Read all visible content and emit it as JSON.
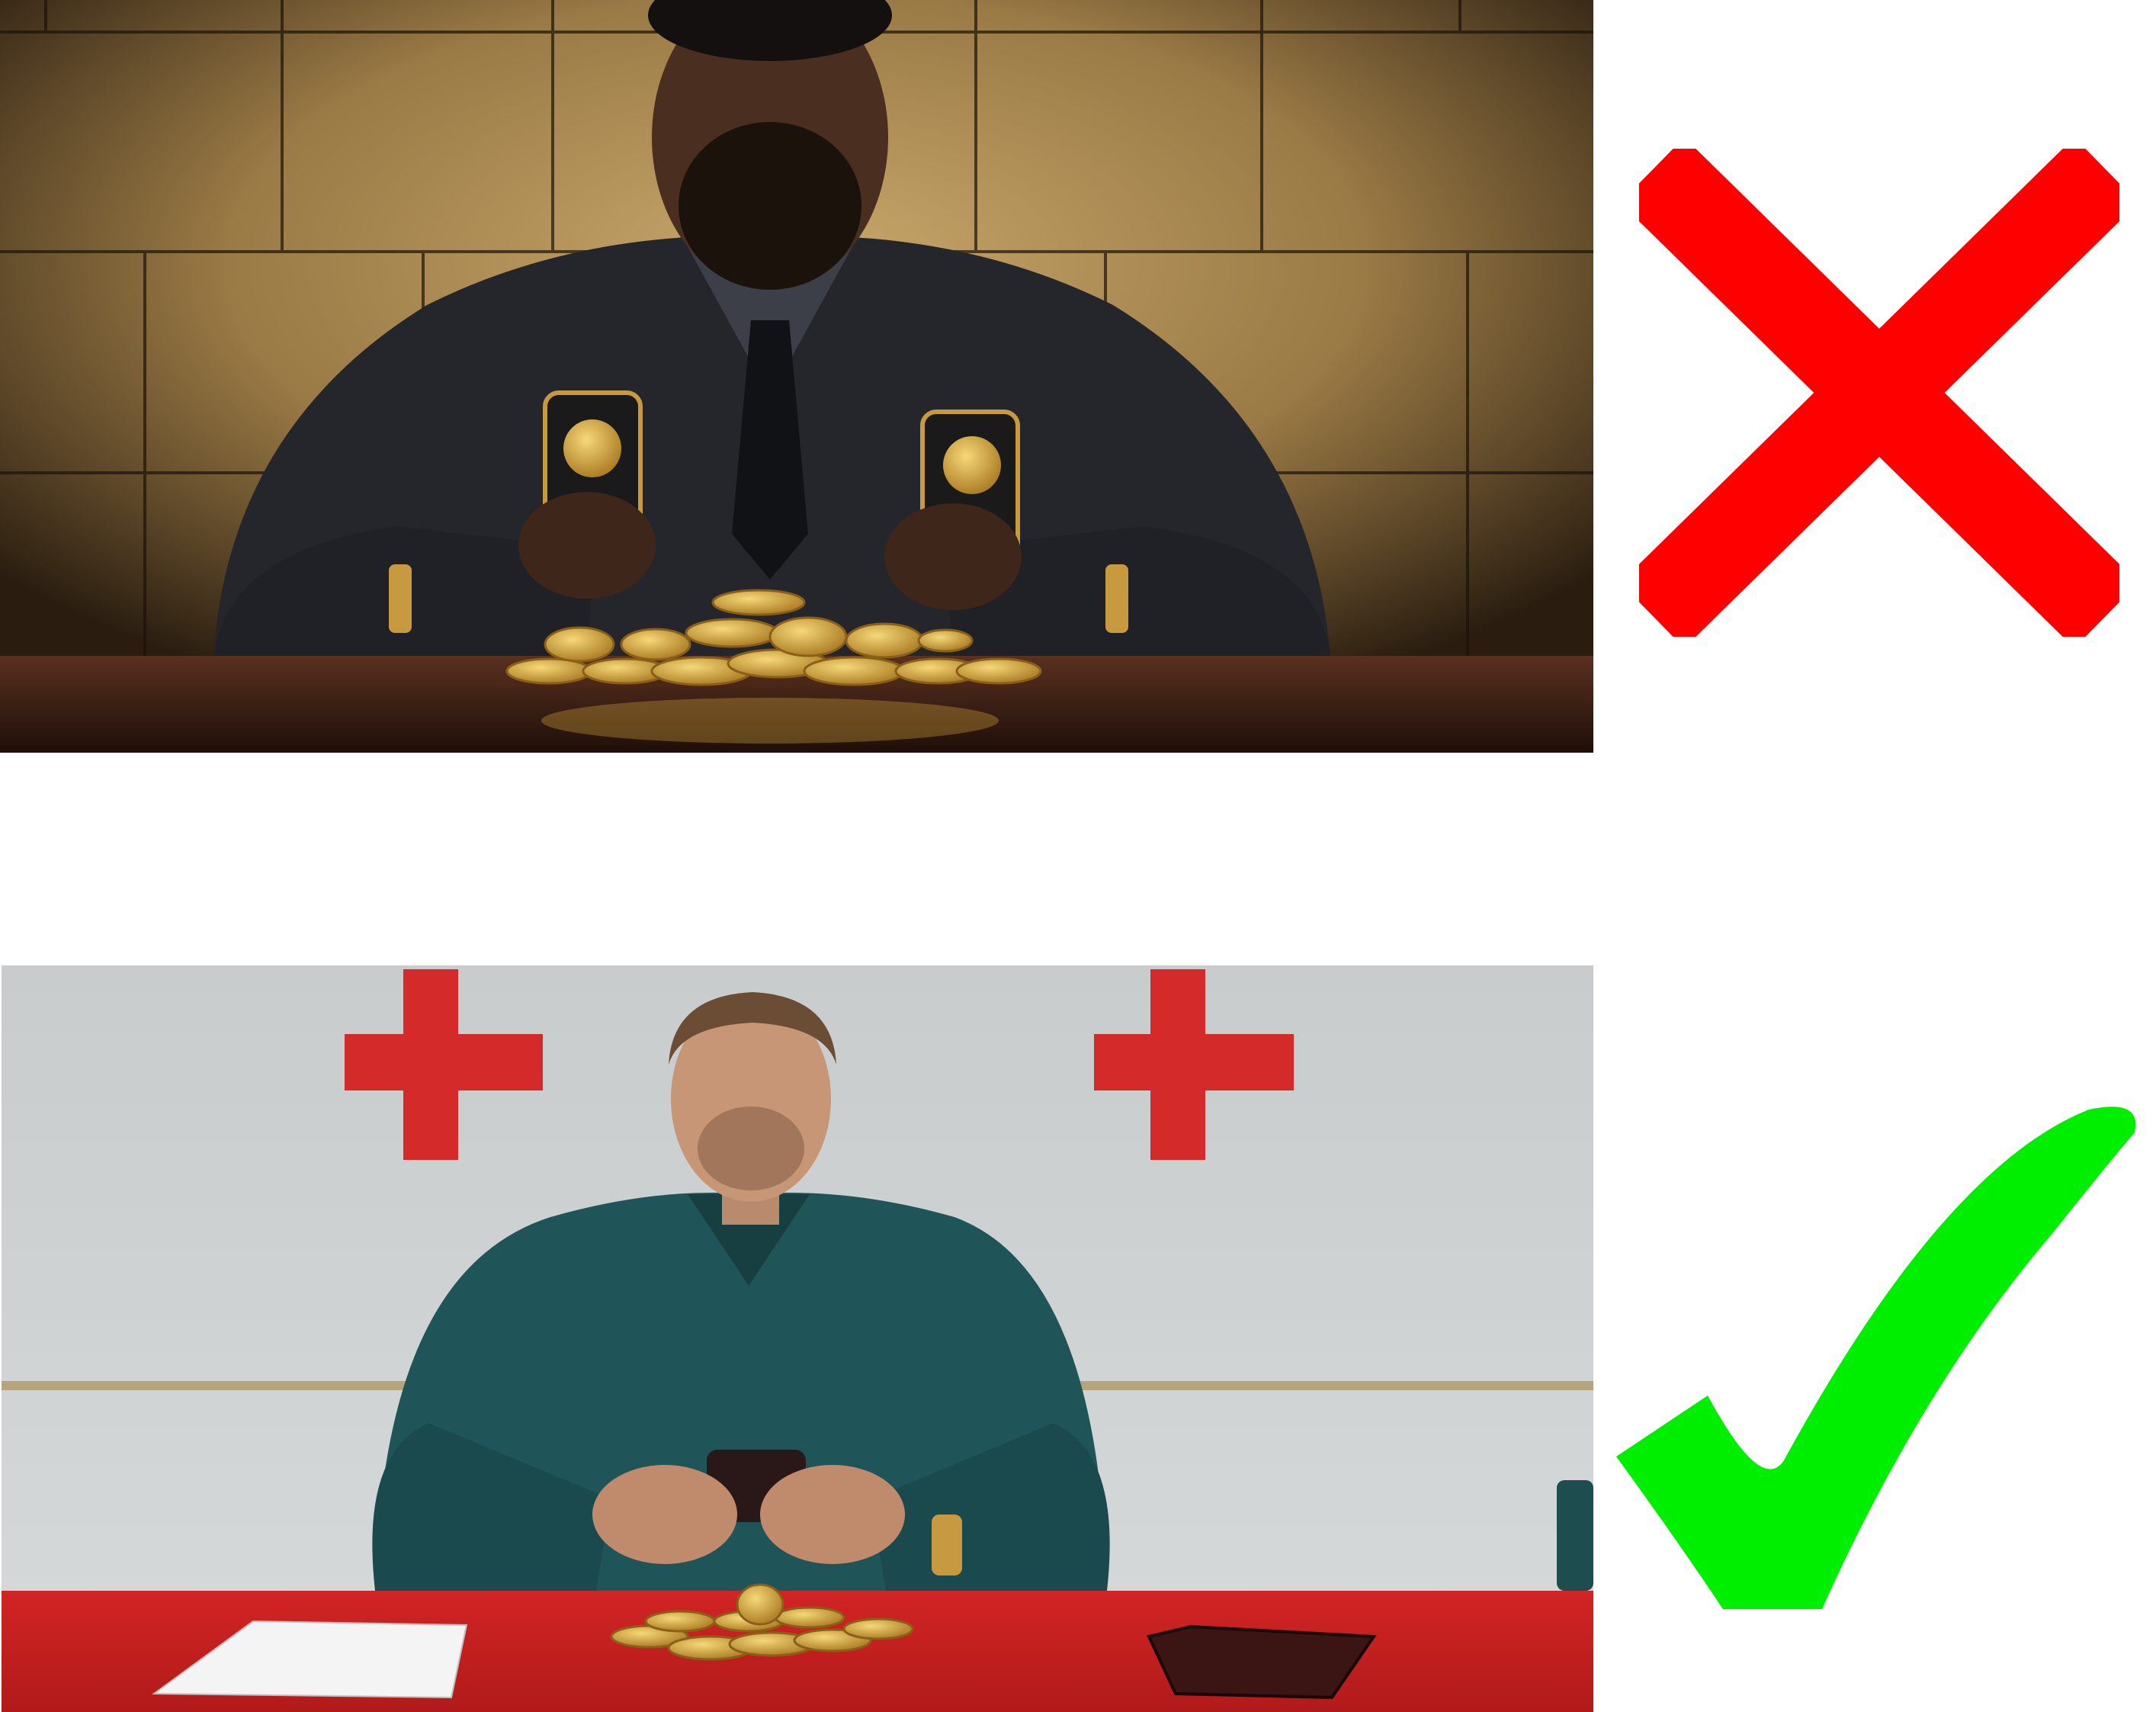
{
  "examples": [
    {
      "subject": "man-in-dark-suit-with-two-phones-and-gold-coins",
      "verdict": "incorrect",
      "marker_icon": "red-cross-icon",
      "marker_color": "#ff0000",
      "palette": {
        "wall": "#b8965a",
        "wall_shadow": "#2e2112",
        "suit": "#25262c",
        "table": "#3a1f14",
        "coin": "#d4a73c"
      }
    },
    {
      "subject": "man-in-teal-shirt-with-phone-and-coins-at-red-table",
      "verdict": "correct",
      "marker_icon": "green-check-icon",
      "marker_color": "#00ee00",
      "palette": {
        "wall": "#cdd1d2",
        "cross_sign": "#d42a2a",
        "shirt": "#1f5559",
        "table": "#c91f1f",
        "coin": "#d4a73c"
      }
    }
  ]
}
